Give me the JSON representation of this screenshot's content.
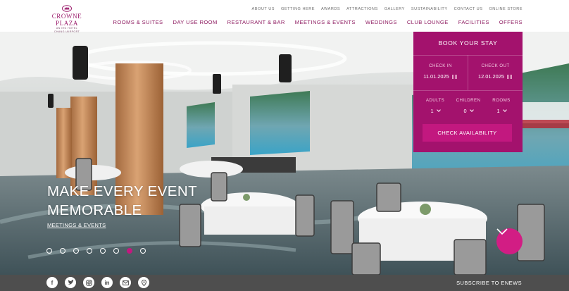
{
  "brand": {
    "name": "CROWNE PLAZA",
    "sub1": "AN IHG HOTEL",
    "sub2": "CHANGI AIRPORT",
    "color": "#9c1e6d"
  },
  "top_nav": [
    "ABOUT US",
    "GETTING HERE",
    "AWARDS",
    "ATTRACTIONS",
    "GALLERY",
    "SUSTAINABILITY",
    "CONTACT US",
    "ONLINE STORE"
  ],
  "main_nav": [
    "ROOMS & SUITES",
    "DAY USE ROOM",
    "RESTAURANT & BAR",
    "MEETINGS & EVENTS",
    "WEDDINGS",
    "CLUB LOUNGE",
    "FACILITIES",
    "OFFERS"
  ],
  "hero": {
    "title_line1": "MAKE EVERY EVENT",
    "title_line2": "MEMORABLE",
    "link": "MEETINGS & EVENTS",
    "slide_count": 8,
    "active_slide": 7
  },
  "booking": {
    "title": "BOOK YOUR STAY",
    "check_in_label": "CHECK IN",
    "check_in_value": "11.01.2025",
    "check_out_label": "CHECK OUT",
    "check_out_value": "12.01.2025",
    "adults_label": "ADULTS",
    "adults_value": "1",
    "children_label": "CHILDREN",
    "children_value": "0",
    "rooms_label": "ROOMS",
    "rooms_value": "1",
    "button": "CHECK AVAILABILITY",
    "color": "#a3126d",
    "button_color": "#c2187f"
  },
  "footer": {
    "socials": [
      "facebook-icon",
      "twitter-icon",
      "instagram-icon",
      "linkedin-icon",
      "email-icon",
      "location-icon"
    ],
    "enews": "SUBSCRIBE TO ENEWS"
  }
}
